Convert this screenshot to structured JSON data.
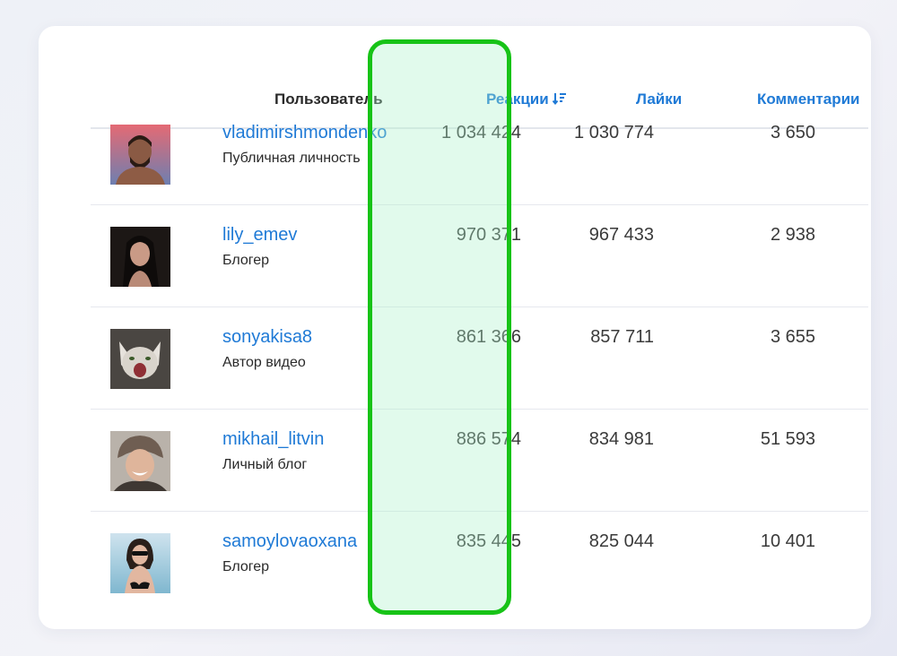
{
  "table": {
    "headers": {
      "user": "Пользователь",
      "reactions": "Реакции",
      "likes": "Лайки",
      "comments": "Комментарии"
    },
    "rows": [
      {
        "username": "vladimirshmondenko",
        "type": "Публичная личность",
        "reactions": "1 034 424",
        "likes": "1 030 774",
        "comments": "3 650"
      },
      {
        "username": "lily_emev",
        "type": "Блогер",
        "reactions": "970 371",
        "likes": "967 433",
        "comments": "2 938"
      },
      {
        "username": "sonyakisa8",
        "type": "Автор видео",
        "reactions": "861 366",
        "likes": "857 711",
        "comments": "3 655"
      },
      {
        "username": "mikhail_litvin",
        "type": "Личный блог",
        "reactions": "886 574",
        "likes": "834 981",
        "comments": "51 593"
      },
      {
        "username": "samoylovaoxana",
        "type": "Блогер",
        "reactions": "835 445",
        "likes": "825 044",
        "comments": "10 401"
      }
    ]
  },
  "colors": {
    "link": "#1f7ad6",
    "highlight_border": "#17c317",
    "highlight_fill": "#dcfbe8"
  },
  "icons": {
    "sort": "sort-descending-icon"
  }
}
